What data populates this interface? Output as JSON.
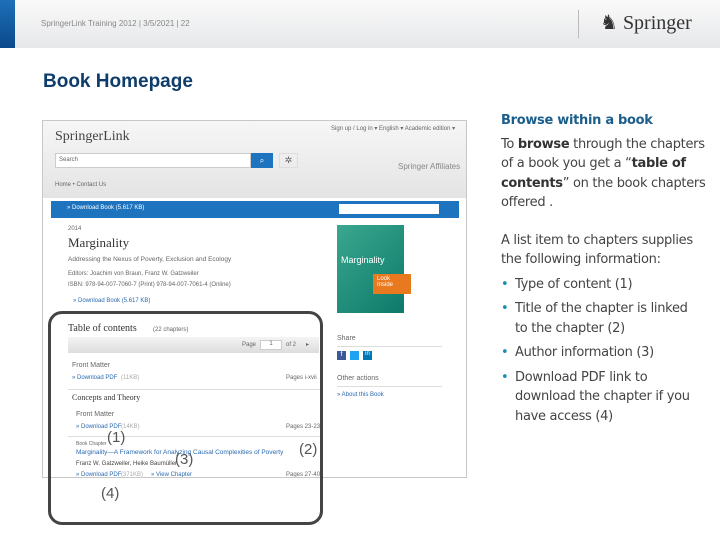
{
  "header": {
    "footer_text": "SpringerLink Training 2012 | 3/5/2021 | 22",
    "logo": "Springer"
  },
  "title": "Book Homepage",
  "screenshot": {
    "logo": "SpringerLink",
    "search_placeholder": "Search",
    "top_links": "Sign up / Log in ▾   English ▾   Academic edition ▾",
    "affiliates": "Springer Affiliates",
    "nav": "Home  •  Contact Us",
    "download_book": "» Download Book (5.617 KB)",
    "year": "2014",
    "book_title": "Marginality",
    "subtitle": "Addressing the Nexus of Poverty, Exclusion and Ecology",
    "editors": "Editors: Joachim von Braun, Franz W. Gatzweiler",
    "isbn": "ISBN: 978-94-007-7060-7 (Print) 978-94-007-7061-4 (Online)",
    "look_inside": "Look Inside",
    "cover_title": "Marginality",
    "toc_title": "Table of contents",
    "toc_count": "(22 chapters)",
    "page_label": "Page",
    "page_value": "1",
    "page_of": "of 2",
    "front_matter": "Front Matter",
    "download_pdf_1": "» Download PDF",
    "size_1": "(11KB)",
    "pages_1": "Pages i-xvii",
    "section": "Concepts and Theory",
    "front_matter_2": "Front Matter",
    "download_pdf_2": "» Download PDF",
    "size_2": "(14KB)",
    "pages_2": "Pages 23-23",
    "content_type": "Book Chapter",
    "chapter_title": "Marginality—A Framework for Analyzing Causal Complexities of Poverty",
    "authors": "Franz W. Gatzweiler, Heike Baumüller",
    "download_pdf_3": "» Download PDF",
    "size_3": "(371KB)",
    "view_chapter": "» View Chapter",
    "pages_3": "Pages 27-40",
    "share": "Share",
    "other_actions": "Other actions",
    "about": "» About this Book"
  },
  "annotations": {
    "a1": "(1)",
    "a2": "(2)",
    "a3": "(3)",
    "a4": "(4)"
  },
  "side": {
    "heading": "Browse within a book",
    "p1_a": "To ",
    "p1_b": "browse",
    "p1_c": " through the chapters of a book you get a “",
    "p1_d": "table of contents",
    "p1_e": "” on the book chapters offered .",
    "p2": "A list item to chapters supplies the following information:",
    "bullets": [
      "Type of content (1)",
      "Title of the chapter is linked to the chapter (2)",
      "Author information (3)",
      "Download PDF link to download the chapter if you have access (4)"
    ]
  }
}
